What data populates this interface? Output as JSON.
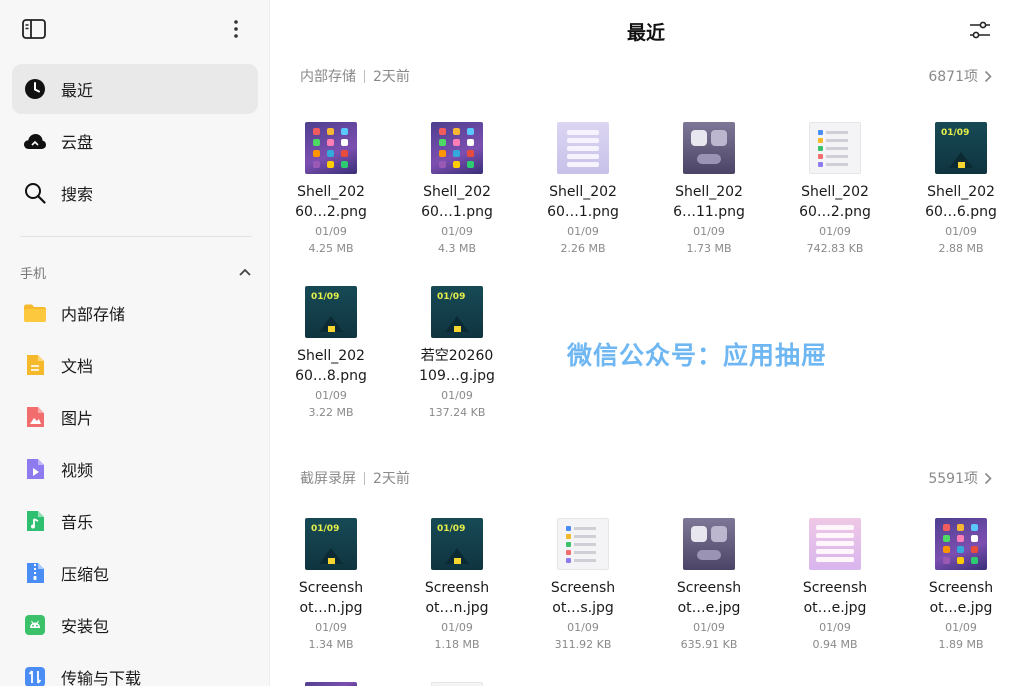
{
  "sidebar": {
    "nav": [
      {
        "label": "最近",
        "icon": "clock-icon",
        "active": true
      },
      {
        "label": "云盘",
        "icon": "cloud-icon",
        "active": false
      },
      {
        "label": "搜索",
        "icon": "search-icon",
        "active": false
      }
    ],
    "section_label": "手机",
    "categories": [
      {
        "label": "内部存储",
        "icon": "folder-icon",
        "color": "#f6b92b"
      },
      {
        "label": "文档",
        "icon": "document-icon",
        "color": "#f6b92b"
      },
      {
        "label": "图片",
        "icon": "image-icon",
        "color": "#f26d6d"
      },
      {
        "label": "视频",
        "icon": "video-icon",
        "color": "#8e7bf0"
      },
      {
        "label": "音乐",
        "icon": "music-icon",
        "color": "#2fbf71"
      },
      {
        "label": "压缩包",
        "icon": "archive-icon",
        "color": "#4a8ef5"
      },
      {
        "label": "安装包",
        "icon": "android-icon",
        "color": "#3cc16b"
      },
      {
        "label": "传输与下载",
        "icon": "transfer-icon",
        "color": "#4a8ef5"
      }
    ]
  },
  "header": {
    "title": "最近"
  },
  "sections": [
    {
      "source": "内部存储",
      "time": "2天前",
      "count": "6871项",
      "files": [
        {
          "name1": "Shell_202",
          "name2": "60…2.png",
          "date": "01/09",
          "size": "4.25 MB",
          "thumb": "purple"
        },
        {
          "name1": "Shell_202",
          "name2": "60…1.png",
          "date": "01/09",
          "size": "4.3 MB",
          "thumb": "purple"
        },
        {
          "name1": "Shell_202",
          "name2": "60…1.png",
          "date": "01/09",
          "size": "2.26 MB",
          "thumb": "light"
        },
        {
          "name1": "Shell_202",
          "name2": "6…11.png",
          "date": "01/09",
          "size": "1.73 MB",
          "thumb": "dark"
        },
        {
          "name1": "Shell_202",
          "name2": "60…2.png",
          "date": "01/09",
          "size": "742.83 KB",
          "thumb": "white"
        },
        {
          "name1": "Shell_202",
          "name2": "60…6.png",
          "date": "01/09",
          "size": "2.88 MB",
          "thumb": "teal"
        },
        {
          "name1": "Shell_202",
          "name2": "60…8.png",
          "date": "01/09",
          "size": "3.22 MB",
          "thumb": "teal"
        },
        {
          "name1": "若空20260",
          "name2": "109…g.jpg",
          "date": "01/09",
          "size": "137.24 KB",
          "thumb": "teal"
        }
      ]
    },
    {
      "source": "截屏录屏",
      "time": "2天前",
      "count": "5591项",
      "files": [
        {
          "name1": "Screensh",
          "name2": "ot…n.jpg",
          "date": "01/09",
          "size": "1.34 MB",
          "thumb": "teal"
        },
        {
          "name1": "Screensh",
          "name2": "ot…n.jpg",
          "date": "01/09",
          "size": "1.18 MB",
          "thumb": "teal"
        },
        {
          "name1": "Screensh",
          "name2": "ot…s.jpg",
          "date": "01/09",
          "size": "311.92 KB",
          "thumb": "white"
        },
        {
          "name1": "Screensh",
          "name2": "ot…e.jpg",
          "date": "01/09",
          "size": "635.91 KB",
          "thumb": "dark"
        },
        {
          "name1": "Screensh",
          "name2": "ot…e.jpg",
          "date": "01/09",
          "size": "0.94 MB",
          "thumb": "pink"
        },
        {
          "name1": "Screensh",
          "name2": "ot…e.jpg",
          "date": "01/09",
          "size": "1.89 MB",
          "thumb": "purple"
        }
      ]
    }
  ],
  "watermark": "微信公众号：应用抽屉"
}
